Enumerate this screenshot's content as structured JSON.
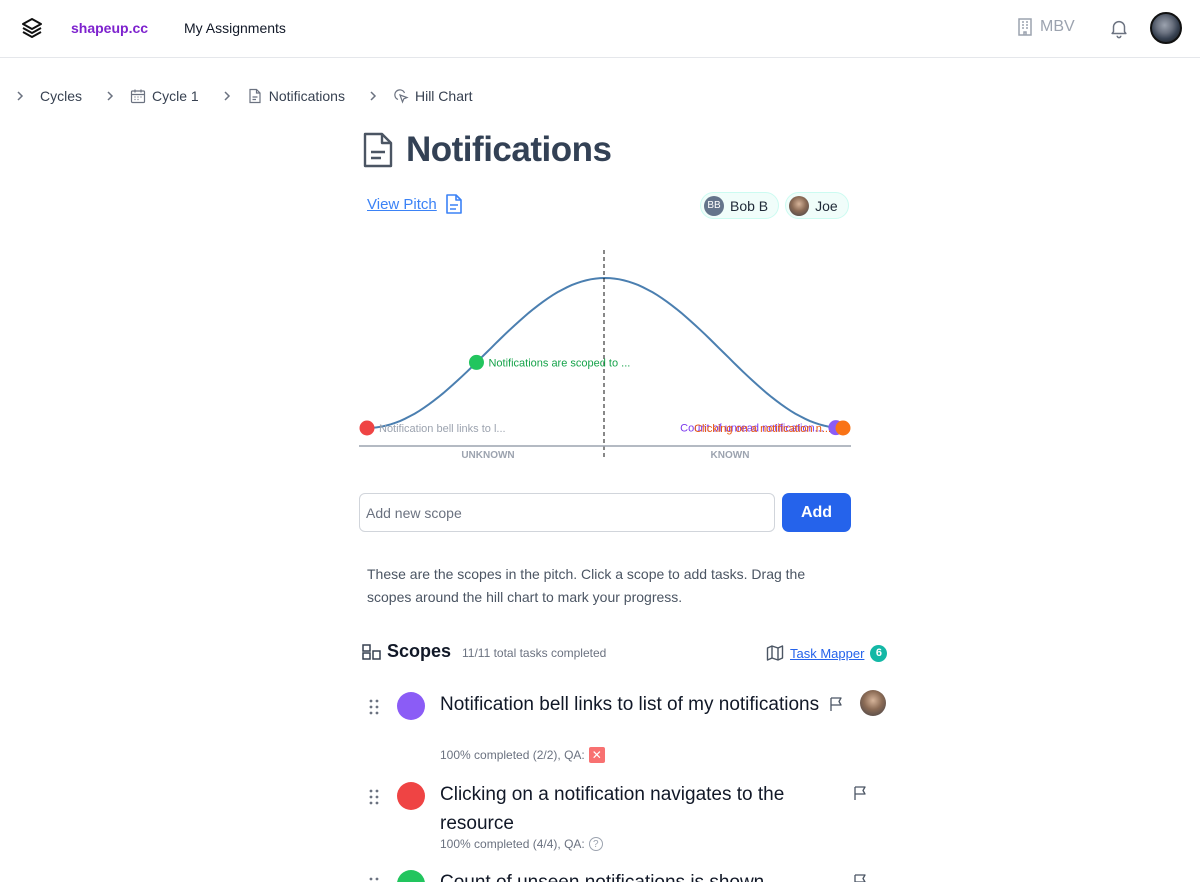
{
  "header": {
    "brand": "shapeup.cc",
    "nav_link": "My Assignments",
    "org_label": "MBV"
  },
  "breadcrumb": [
    "Cycles",
    "Cycle 1",
    "Notifications",
    "Hill Chart"
  ],
  "page": {
    "title": "Notifications",
    "view_pitch": "View Pitch"
  },
  "people": [
    {
      "initials": "BB",
      "name": "Bob B"
    },
    {
      "name": "Joe"
    }
  ],
  "hill_chart": {
    "left_label": "UNKNOWN",
    "right_label": "KNOWN",
    "curve_color": "#4b7fb0",
    "points": [
      {
        "label": "Notification bell links to l...",
        "progress": 0.0,
        "color": "#ef4444",
        "label_color": "#9ca3af",
        "label_side": "right"
      },
      {
        "label": "Notifications are scoped to ...",
        "progress": 0.23,
        "color": "#22c55e",
        "label_color": "#16a34a",
        "label_side": "right"
      },
      {
        "label": "Count of unread notification...",
        "progress": 0.985,
        "color": "#8b5cf6",
        "label_color": "#7c3aed",
        "label_side": "left"
      },
      {
        "label": "Clicking on a notification n...",
        "progress": 1.0,
        "color": "#f97316",
        "label_color": "#ea580c",
        "label_side": "left"
      }
    ]
  },
  "add_scope": {
    "placeholder": "Add new scope",
    "button": "Add"
  },
  "help_text": "These are the scopes in the pitch. Click a scope to add tasks. Drag the scopes around the hill chart to mark your progress.",
  "scopes_section": {
    "title": "Scopes",
    "subtitle": "11/11 total tasks completed",
    "task_mapper": "Task Mapper",
    "task_mapper_count": "6"
  },
  "scopes": [
    {
      "name": "Notification bell links to list of my notifications",
      "meta": "100% completed (2/2), QA:",
      "qa": "fail",
      "color": "#8b5cf6",
      "qa_icon": "x-icon",
      "owner": true
    },
    {
      "name": "Clicking on a notification navigates to the resource",
      "meta": "100% completed (4/4), QA:",
      "qa": "unknown",
      "color": "#ef4444",
      "qa_icon": "question-icon",
      "owner": false
    },
    {
      "name": "Count of unseen notifications is shown above",
      "meta": "",
      "qa": "",
      "color": "#22c55e",
      "owner": false
    }
  ]
}
